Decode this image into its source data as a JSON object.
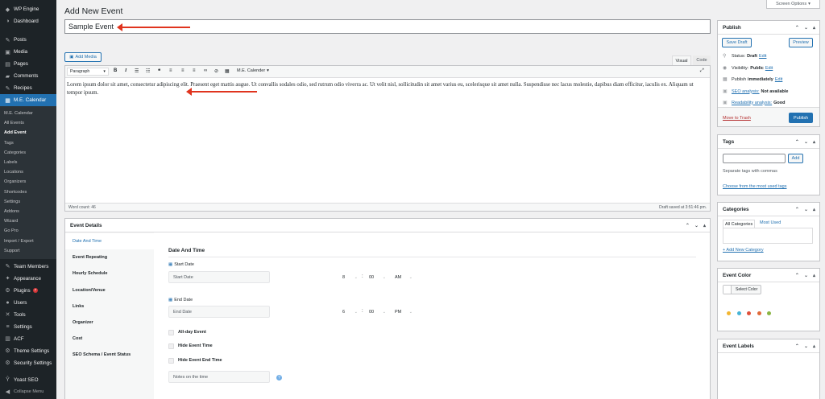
{
  "sidebar": {
    "top": [
      {
        "icon": "wp-engine-icon",
        "glyph": "◆",
        "label": "WP Engine"
      },
      {
        "icon": "dashboard-icon",
        "glyph": "◑",
        "label": "Dashboard"
      }
    ],
    "mid": [
      {
        "icon": "pin-icon",
        "glyph": "✎",
        "label": "Posts"
      },
      {
        "icon": "media-icon",
        "glyph": "▣",
        "label": "Media"
      },
      {
        "icon": "pages-icon",
        "glyph": "▤",
        "label": "Pages"
      },
      {
        "icon": "comments-icon",
        "glyph": "▰",
        "label": "Comments"
      },
      {
        "icon": "recipes-icon",
        "glyph": "✎",
        "label": "Recipes"
      }
    ],
    "active": {
      "icon": "calendar-icon",
      "glyph": "▦",
      "label": "M.E. Calendar"
    },
    "submenu": [
      "M.E. Calendar",
      "All Events",
      "Add Event",
      "Tags",
      "Categories",
      "Labels",
      "Locations",
      "Organizers",
      "Shortcodes",
      "Settings",
      "Addons",
      "Wizard",
      "Go Pro",
      "Import / Export",
      "Support"
    ],
    "current_submenu": "Add Event",
    "bottom": [
      {
        "icon": "team-icon",
        "glyph": "✎",
        "label": "Team Members"
      },
      {
        "icon": "appearance-icon",
        "glyph": "✦",
        "label": "Appearance"
      },
      {
        "icon": "plugins-icon",
        "glyph": "⚙",
        "label": "Plugins",
        "badge": "7"
      },
      {
        "icon": "users-icon",
        "glyph": "●",
        "label": "Users"
      },
      {
        "icon": "tools-icon",
        "glyph": "✕",
        "label": "Tools"
      },
      {
        "icon": "settings-icon",
        "glyph": "≡",
        "label": "Settings"
      },
      {
        "icon": "acf-icon",
        "glyph": "▥",
        "label": "ACF"
      },
      {
        "icon": "theme-settings-icon",
        "glyph": "⚙",
        "label": "Theme Settings"
      },
      {
        "icon": "security-icon",
        "glyph": "⚙",
        "label": "Security Settings"
      }
    ],
    "yoast": {
      "icon": "yoast-icon",
      "glyph": "Ŷ",
      "label": "Yoast SEO"
    },
    "collapse": {
      "icon": "collapse-icon",
      "glyph": "◀",
      "label": "Collapse Menu"
    }
  },
  "screen_options": "Screen Options",
  "page_title": "Add New Event",
  "title_value": "Sample Event",
  "add_media": "Add Media",
  "editor": {
    "tab_visual": "Visual",
    "tab_code": "Code",
    "format": "Paragraph",
    "calendar_dropdown": "M.E. Calender",
    "content": "Lorem ipsum dolor sit amet, consectetur adipiscing elit. Praesent eget mattis augue. Ut convallis sodales odio, sed rutrum odio viverra ac. Ut velit nisl, sollicitudin sit amet varius eu, scelerisque sit amet nulla. Suspendisse nec lacus molestie, dapibus diam efficitur, iaculis ex. Aliquam ut tempor ipsum.",
    "word_count": "Word count: 46",
    "draft_saved": "Draft saved at 3:51:46 pm."
  },
  "event_details": {
    "title": "Event Details",
    "tabs": [
      "Date And Time",
      "Event Repeating",
      "Hourly Schedule",
      "Location/Venue",
      "Links",
      "Organizer",
      "Cost",
      "SEO Schema / Event Status"
    ],
    "section_title": "Date And Time",
    "start_label": "Start Date",
    "start_placeholder": "Start Date",
    "start_hour": "8",
    "start_min": "00",
    "start_ampm": "AM",
    "colon": ":",
    "end_label": "End Date",
    "end_placeholder": "End Date",
    "end_hour": "6",
    "end_min": "00",
    "end_ampm": "PM",
    "allday": "All-day Event",
    "hide_time": "Hide Event Time",
    "hide_end": "Hide Event End Time",
    "notes_placeholder": "Notes on the time"
  },
  "publish": {
    "title": "Publish",
    "save_draft": "Save Draft",
    "preview": "Preview",
    "status_label": "Status:",
    "status_value": "Draft",
    "visibility_label": "Visibility:",
    "visibility_value": "Public",
    "publish_label": "Publish",
    "publish_value": "immediately",
    "edit": "Edit",
    "seo_link": "SEO analysis:",
    "seo_value": "Not available",
    "read_link": "Readability analysis:",
    "read_value": "Good",
    "trash": "Move to Trash",
    "publish_button": "Publish"
  },
  "tags": {
    "title": "Tags",
    "add": "Add",
    "help": "Separate tags with commas",
    "choose": "Choose from the most used tags"
  },
  "categories": {
    "title": "Categories",
    "tab_all": "All Categories",
    "tab_most": "Most Used",
    "add_new": "+ Add New Category"
  },
  "event_color": {
    "title": "Event Color",
    "button": "Select Color",
    "swatches": [
      "#f2b632",
      "#47b4d6",
      "#e0503a",
      "#e06a3a",
      "#8ab543"
    ]
  },
  "event_labels": {
    "title": "Event Labels"
  }
}
